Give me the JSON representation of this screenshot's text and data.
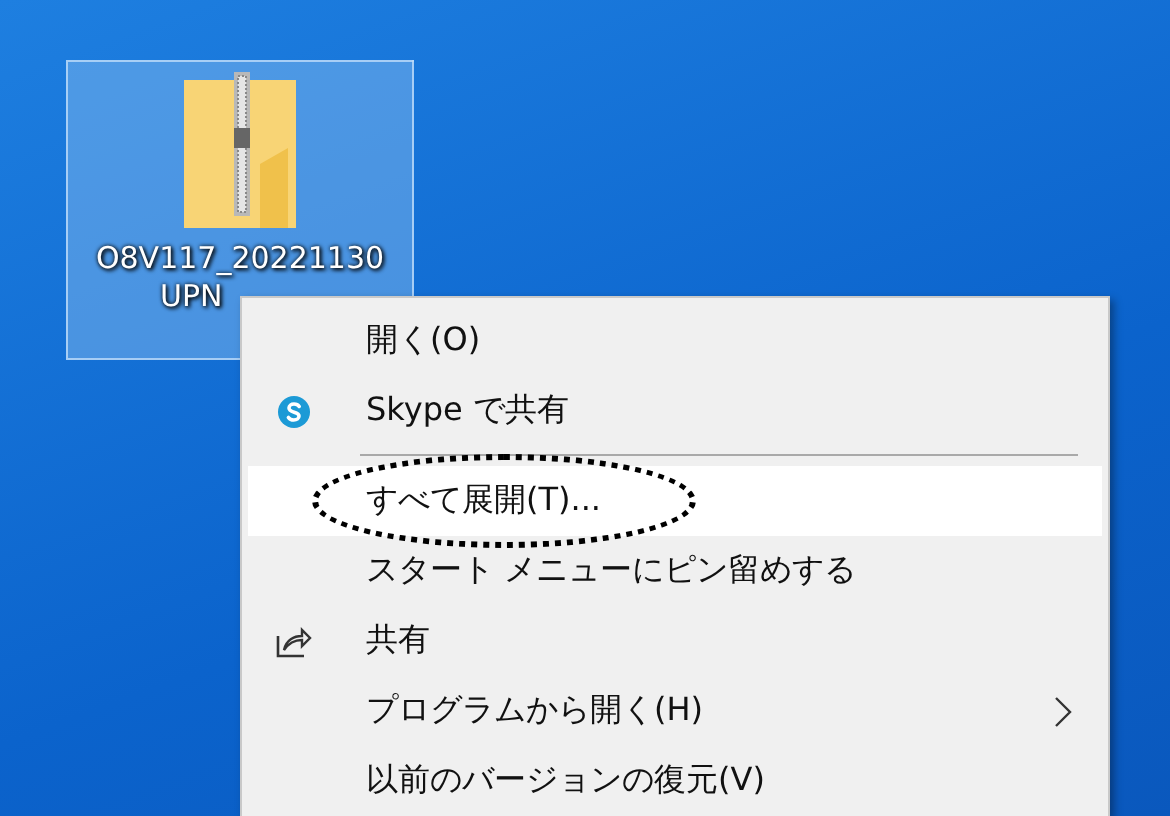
{
  "desktop_icon": {
    "label_lines": [
      "O8V117_20221130",
      "UPN"
    ],
    "selected": true
  },
  "context_menu": {
    "items": [
      {
        "kind": "plain",
        "label": "開く(O)",
        "selected": false,
        "circled": false,
        "submenu": false
      },
      {
        "kind": "skype",
        "label": "Skype で共有",
        "selected": false,
        "circled": false,
        "submenu": false
      },
      {
        "kind": "separator"
      },
      {
        "kind": "plain",
        "label": "すべて展開(T)...",
        "selected": true,
        "circled": true,
        "submenu": false
      },
      {
        "kind": "plain",
        "label": "スタート メニューにピン留めする",
        "selected": false,
        "circled": false,
        "submenu": false
      },
      {
        "kind": "share",
        "label": "共有",
        "selected": false,
        "circled": false,
        "submenu": false
      },
      {
        "kind": "plain",
        "label": "プログラムから開く(H)",
        "selected": false,
        "circled": false,
        "submenu": true
      },
      {
        "kind": "plain",
        "label": "以前のバージョンの復元(V)",
        "selected": false,
        "circled": false,
        "submenu": false
      }
    ]
  }
}
